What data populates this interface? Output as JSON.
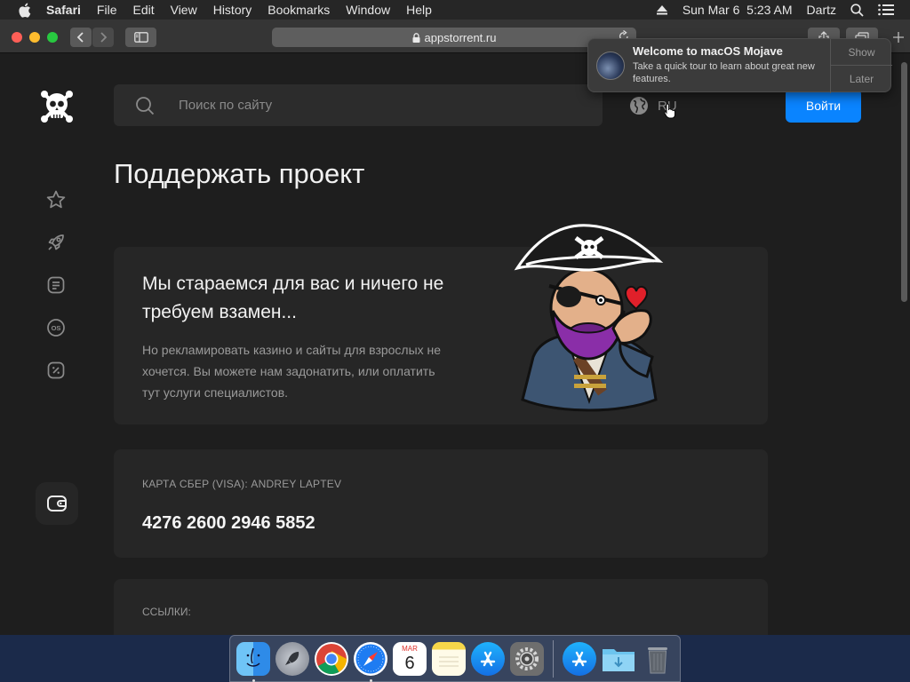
{
  "menubar": {
    "app_name": "Safari",
    "items": [
      "File",
      "Edit",
      "View",
      "History",
      "Bookmarks",
      "Window",
      "Help"
    ],
    "clock": "Sun Mar 6  5:23 AM",
    "user": "Dartz"
  },
  "browser": {
    "url": "appstorrent.ru"
  },
  "notification": {
    "title": "Welcome to macOS Mojave",
    "body": "Take a quick tour to learn about great new features.",
    "show_label": "Show",
    "later_label": "Later"
  },
  "site": {
    "search_placeholder": "Поиск по сайту",
    "language": "RU",
    "login_label": "Войти",
    "sidebar_icons": [
      "star-icon",
      "rocket-icon",
      "document-icon",
      "os-icon",
      "discount-icon"
    ],
    "page_title": "Поддержать проект",
    "hero": {
      "title": "Мы стараемся для вас и ничего не требуем взамен...",
      "text": "Но рекламировать казино и сайты для взрослых не хочется. Вы можете нам задонатить, или оплатить тут услуги специалистов."
    },
    "bank": {
      "label": "КАРТА СБЕР (VISA): ANDREY LAPTEV",
      "number": "4276 2600 2946 5852"
    },
    "links": {
      "label": "ССЫЛКИ:"
    }
  },
  "dock": {
    "apps": [
      "Finder",
      "Launchpad",
      "Google Chrome",
      "Safari",
      "Calendar",
      "Notes",
      "App Store",
      "System Preferences",
      "App Store",
      "Downloads",
      "Trash"
    ],
    "calendar_month": "MAR",
    "calendar_day": "6"
  },
  "colors": {
    "accent": "#0a84ff",
    "page_bg": "#1e1e1e",
    "card_bg": "#262626"
  }
}
